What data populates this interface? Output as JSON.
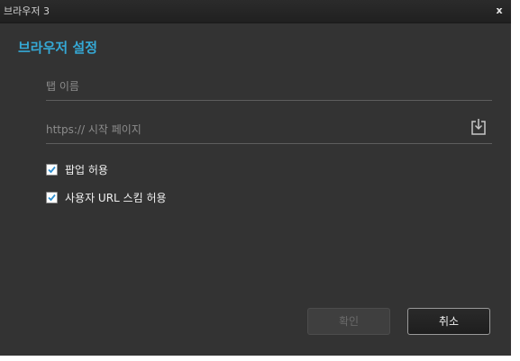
{
  "window": {
    "title": "브라우저 3",
    "close_label": "x"
  },
  "dialog": {
    "heading": "브라우저 설정"
  },
  "fields": {
    "tab_name": {
      "placeholder": "탭 이름",
      "value": ""
    },
    "home_page": {
      "placeholder": "https:// 시작 페이지",
      "value": ""
    }
  },
  "options": {
    "allow_popup": {
      "label": "팝업 허용",
      "checked": true
    },
    "allow_url_scheme": {
      "label": "사용자 URL 스킴 허용",
      "checked": true
    }
  },
  "buttons": {
    "ok_label": "확인",
    "ok_enabled": false,
    "cancel_label": "취소"
  },
  "icons": {
    "close": "close-icon",
    "download": "download-icon",
    "checkmark": "checkmark-icon"
  },
  "colors": {
    "accent": "#35a9d6",
    "background": "#333333",
    "titlebar": "#242424"
  }
}
